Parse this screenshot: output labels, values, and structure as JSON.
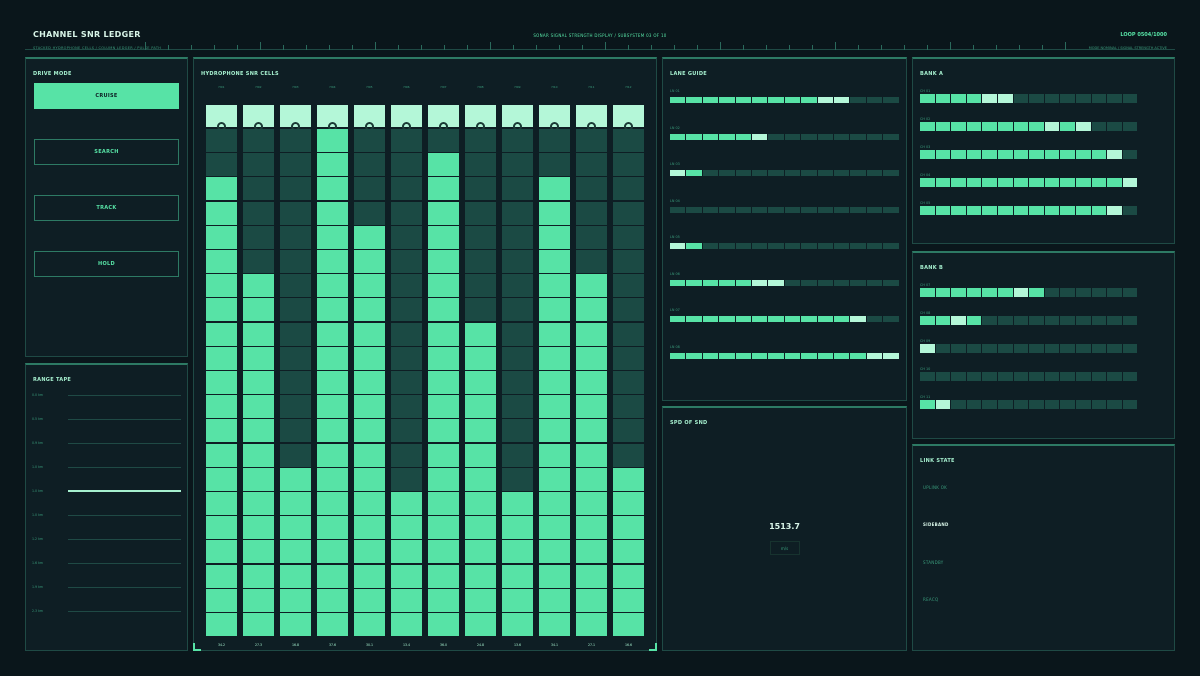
{
  "header": {
    "title": "CHANNEL SNR LEDGER",
    "subtitle": "STACKED HYDROPHONE CELLS / COLUMN LEDGER / PULSE PATH",
    "center": "SONAR SIGNAL STRENGTH DISPLAY / SUBSYSTEM 03 OF 10",
    "loop": "LOOP 0504/1000",
    "right_sub": "MODE NOMINAL / SIGNAL STRENGTH ACTIVE"
  },
  "drive_mode": {
    "label": "DRIVE MODE",
    "buttons": [
      "CRUISE",
      "SEARCH",
      "TRACK",
      "HOLD"
    ],
    "selected": "CRUISE"
  },
  "range_tape": {
    "label": "RANGE TAPE",
    "marks": [
      "0.0 km",
      "0.5 km",
      "0.9 km",
      "1.0 km",
      "1.0 km",
      "1.0 km",
      "1.2 km",
      "1.6 km",
      "1.9 km",
      "2.3 km"
    ],
    "highlight_index": 4
  },
  "snr": {
    "label": "HYDROPHONE SNR CELLS",
    "columns": [
      {
        "name": "H01",
        "level": 19,
        "value": "34.2"
      },
      {
        "name": "H02",
        "level": 15,
        "value": "27.3"
      },
      {
        "name": "H03",
        "level": 7,
        "value": "16.8"
      },
      {
        "name": "H04",
        "level": 21,
        "value": "37.6"
      },
      {
        "name": "H05",
        "level": 17,
        "value": "30.1"
      },
      {
        "name": "H06",
        "level": 6,
        "value": "13.4"
      },
      {
        "name": "H07",
        "level": 20,
        "value": "36.0"
      },
      {
        "name": "H08",
        "level": 13,
        "value": "24.8"
      },
      {
        "name": "H09",
        "level": 6,
        "value": "13.6"
      },
      {
        "name": "H10",
        "level": 19,
        "value": "34.1"
      },
      {
        "name": "H11",
        "level": 15,
        "value": "27.1"
      },
      {
        "name": "H12",
        "level": 7,
        "value": "16.6"
      }
    ],
    "total_cells": 21
  },
  "lane_guide": {
    "label": "LANE GUIDE",
    "lanes": [
      {
        "name": "LN 01",
        "pattern": "11111111122000"
      },
      {
        "name": "LN 02",
        "pattern": "11111200000000"
      },
      {
        "name": "LN 03",
        "pattern": "21000000000000"
      },
      {
        "name": "LN 04",
        "pattern": "00000000000000"
      },
      {
        "name": "LN 05",
        "pattern": "21000000000000"
      },
      {
        "name": "LN 06",
        "pattern": "11111220000000"
      },
      {
        "name": "LN 07",
        "pattern": "11111111111200"
      },
      {
        "name": "LN 08",
        "pattern": "11111111111122"
      }
    ]
  },
  "bank_a": {
    "label": "BANK A",
    "rows": [
      {
        "name": "CH 01",
        "pattern": "11112200000000"
      },
      {
        "name": "CH 02",
        "pattern": "11111111212000"
      },
      {
        "name": "CH 03",
        "pattern": "11111111111120"
      },
      {
        "name": "CH 04",
        "pattern": "11111111111112"
      },
      {
        "name": "CH 05",
        "pattern": "11111111111120"
      }
    ]
  },
  "bank_b": {
    "label": "BANK B",
    "rows": [
      {
        "name": "CH 07",
        "pattern": "11111121000000"
      },
      {
        "name": "CH 08",
        "pattern": "11210000000000"
      },
      {
        "name": "CH 09",
        "pattern": "20000000000000"
      },
      {
        "name": "CH 10",
        "pattern": "00000000000000"
      },
      {
        "name": "CH 11",
        "pattern": "12000000000000"
      }
    ]
  },
  "spd": {
    "label": "SPD OF SND",
    "value": "1513.7",
    "unit": "m/s"
  },
  "link_state": {
    "label": "LINK STATE",
    "items": [
      "UPLINK OK",
      "SIDEBAND",
      "STANDBY",
      "REACQ"
    ],
    "active": "SIDEBAND"
  },
  "colors": {
    "background": "#0a161b",
    "panel": "#0e1e24",
    "accent": "#57e3a6",
    "highlight": "#b4f7d8",
    "dim": "#1b4a44"
  }
}
